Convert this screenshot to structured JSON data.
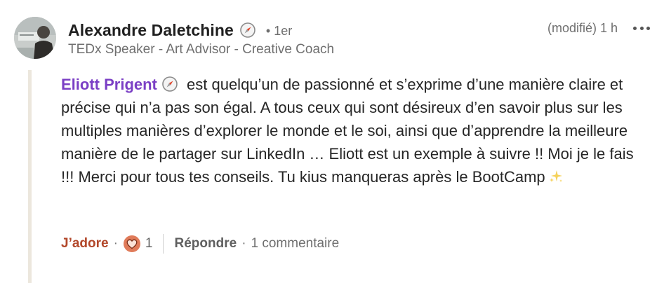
{
  "author": {
    "name": "Alexandre Daletchine",
    "degree": "• 1er",
    "headline": "TEDx Speaker - Art Advisor - Creative Coach",
    "badge_icon": "compass-icon"
  },
  "meta": {
    "edited_time": "(modifié) 1 h",
    "more_icon": "more-options-icon"
  },
  "body": {
    "mention": "Eliott Prigent",
    "text": "est quelqu’un de passionné et s’exprime d’une manière claire et précise qui n’a pas son égal. A tous ceux qui sont désireux d’en savoir plus sur les multiples manières d’explorer le monde et le soi, ainsi que d’apprendre la meilleure manière de le partager sur LinkedIn … Eliott est un exemple à suivre !! Moi je le fais !!! Merci pour tous tes conseils. Tu kius manqueras après le BootCamp",
    "trailing_emoji": "sparkles-icon"
  },
  "actions": {
    "react_label": "J’adore",
    "separator": "·",
    "reaction_icon": "love-reaction-icon",
    "reaction_count": "1",
    "reply_label": "Répondre",
    "reply_count": "1 commentaire"
  },
  "colors": {
    "mention": "#7b3fc5",
    "react_active": "#b2472a",
    "thread_line": "#ece7dd",
    "meta_text": "#6e6e6e"
  }
}
